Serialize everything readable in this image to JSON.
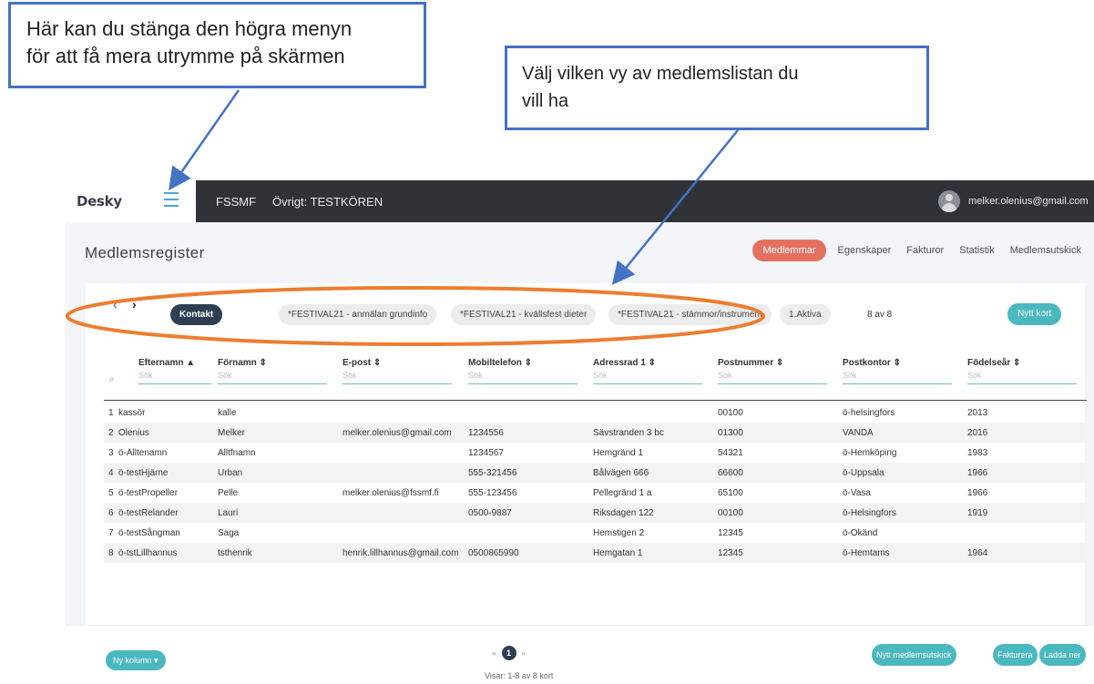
{
  "callouts": {
    "left": [
      "Här kan du stänga den högra menyn",
      "för att få mera utrymme på skärmen"
    ],
    "right": [
      "Välj vilken vy av medlemslistan du",
      "vill ha"
    ]
  },
  "app": {
    "brand": "Desky",
    "org": "FSSMF",
    "other": "Övrigt: TESTKÖREN",
    "user_email": "melker.olenius@gmail.com"
  },
  "page": {
    "title": "Medlemsregister",
    "tabs": [
      {
        "label": "Medlemmar",
        "active": true
      },
      {
        "label": "Egenskaper",
        "active": false
      },
      {
        "label": "Fakturor",
        "active": false
      },
      {
        "label": "Statistik",
        "active": false
      },
      {
        "label": "Medlemsutskick",
        "active": false
      }
    ]
  },
  "viewbar": {
    "views": [
      {
        "label": "Kontakt",
        "active": true
      },
      {
        "label": "*FESTIVAL21 - anmälan grundinfo",
        "active": false
      },
      {
        "label": "*FESTIVAL21 - kvällsfest dieter",
        "active": false
      },
      {
        "label": "*FESTIVAL21 - stämmor/instrument",
        "active": false
      },
      {
        "label": "1.Aktiva",
        "active": false
      }
    ],
    "count": "8 av 8",
    "new_card": "Nytt kort"
  },
  "table": {
    "hash": "#",
    "columns": [
      {
        "label": "Efternamn ▲",
        "placeholder": "Sök"
      },
      {
        "label": "Förnamn ⇕",
        "placeholder": "Sök"
      },
      {
        "label": "E-post ⇕",
        "placeholder": "Sök"
      },
      {
        "label": "Mobiltelefon ⇕",
        "placeholder": "Sök"
      },
      {
        "label": "Adressrad 1 ⇕",
        "placeholder": "Sök"
      },
      {
        "label": "Postnummer ⇕",
        "placeholder": "Sök"
      },
      {
        "label": "Postkontor ⇕",
        "placeholder": "Sök"
      },
      {
        "label": "Födelseår ⇕",
        "placeholder": "Sök"
      }
    ],
    "rows": [
      [
        "1",
        "kassör",
        "kalle",
        "",
        "",
        "",
        "00100",
        "ö-helsingfors",
        "2013"
      ],
      [
        "2",
        "Olenius",
        "Melker",
        "melker.olenius@gmail.com",
        "1234556",
        "Sävstranden 3 bc",
        "01300",
        "VANDA",
        "2016"
      ],
      [
        "3",
        "ö-Alltenamn",
        "Alltfnamn",
        "",
        "1234567",
        "Hemgränd 1",
        "54321",
        "ö-Hemköping",
        "1983"
      ],
      [
        "4",
        "ö-testHjärne",
        "Urban",
        "",
        "555-321456",
        "Bålvägen 666",
        "66600",
        "ö-Uppsala",
        "1966"
      ],
      [
        "5",
        "ö-testPropeller",
        "Pelle",
        "melker.olenius@fssmf.fi",
        "555-123456",
        "Pellegränd 1 a",
        "65100",
        "ö-Vasa",
        "1966"
      ],
      [
        "6",
        "ö-testRelander",
        "Lauri",
        "",
        "0500-9887",
        "Riksdagen 122",
        "00100",
        "ö-Helsingfors",
        "1919"
      ],
      [
        "7",
        "ö-testSångman",
        "Saga",
        "",
        "",
        "Hemstigen 2",
        "12345",
        "ö-Okänd",
        ""
      ],
      [
        "8",
        "ö-tstLillhannus",
        "tsthenrik",
        "henrik.lillhannus@gmail.com",
        "0500865990",
        "Hemgatan 1",
        "12345",
        "ö-Hemtams",
        "1964"
      ]
    ]
  },
  "footer": {
    "new_column": "Ny kolumn ▾",
    "prev": "«",
    "page": "1",
    "next": "»",
    "showing": "Visar: 1-8 av 8 kort",
    "buttons": [
      "Nytt medlemsutskick",
      "Fakturera",
      "Ladda ner"
    ]
  }
}
